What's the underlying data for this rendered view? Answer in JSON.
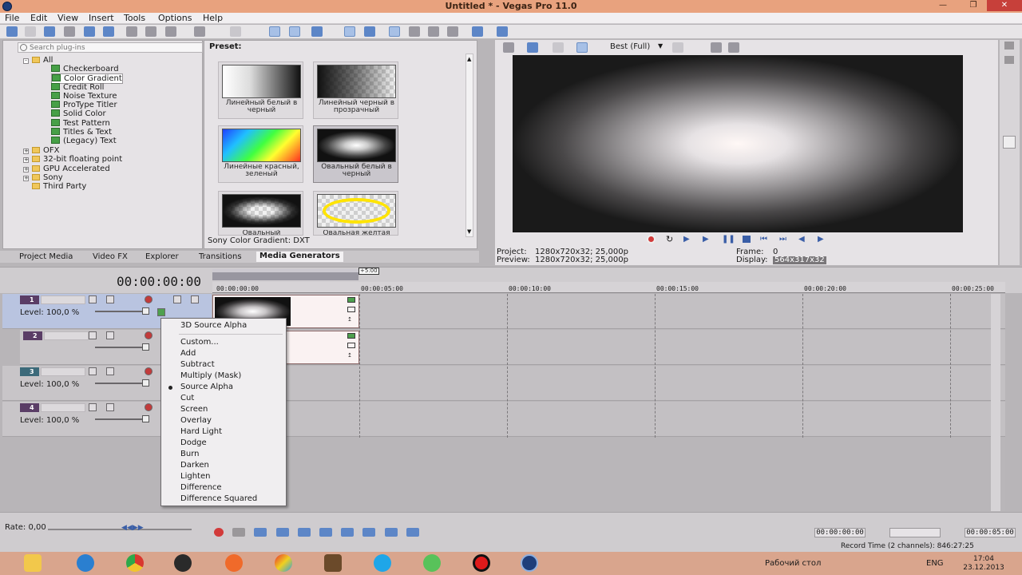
{
  "window": {
    "title": "Untitled * - Vegas Pro 11.0"
  },
  "menu": [
    "File",
    "Edit",
    "View",
    "Insert",
    "Tools",
    "Options",
    "Help"
  ],
  "explorer": {
    "search_placeholder": "Search plug-ins",
    "tree": {
      "root": "All",
      "children": [
        "Checkerboard",
        "Color Gradient",
        "Credit Roll",
        "Noise Texture",
        "ProType Titler",
        "Solid Color",
        "Test Pattern",
        "Titles & Text",
        "(Legacy) Text"
      ],
      "selected_child": "Color Gradient",
      "groups": [
        "OFX",
        "32-bit floating point",
        "GPU Accelerated",
        "Sony",
        "Third Party"
      ]
    }
  },
  "presets": {
    "label": "Preset:",
    "items": [
      {
        "caption": "Линейный белый в черный"
      },
      {
        "caption": "Линейный черный в прозрачный"
      },
      {
        "caption": "Линейные красный, зеленый"
      },
      {
        "caption": "Овальный белый в черный"
      },
      {
        "caption": "Овальный"
      },
      {
        "caption": "Овальная желтая"
      }
    ],
    "footer": "Sony Color Gradient: DXT"
  },
  "tabs": [
    "Project Media",
    "Video FX",
    "Explorer",
    "Transitions",
    "Media Generators"
  ],
  "active_tab": "Media Generators",
  "preview": {
    "quality": "Best (Full)",
    "project_label": "Project:",
    "project_value": "1280x720x32; 25,000p",
    "preview_label": "Preview:",
    "preview_value": "1280x720x32; 25,000p",
    "frame_label": "Frame:",
    "frame_value": "0",
    "display_label": "Display:",
    "display_value": "564x317x32"
  },
  "timeline": {
    "timecode": "00:00:00:00",
    "loop_flag": "+5:00",
    "ticks": [
      "00:00:00:00",
      "00:00:05:00",
      "00:00:10:00",
      "00:00:15:00",
      "00:00:20:00",
      "00:00:25:00"
    ],
    "tracks": [
      {
        "number": "1",
        "level": "Level: 100,0 %"
      },
      {
        "number": "2",
        "level": ""
      },
      {
        "number": "3",
        "level": "Level: 100,0 %"
      },
      {
        "number": "4",
        "level": "Level: 100,0 %"
      }
    ]
  },
  "context_menu": {
    "items": [
      {
        "label": "3D Source Alpha",
        "hotkey": "3"
      },
      {
        "label": "Custom...",
        "hotkey": "C"
      },
      {
        "label": "Add",
        "hotkey": "A"
      },
      {
        "label": "Subtract",
        "hotkey": "S"
      },
      {
        "label": "Multiply (Mask)",
        "hotkey": "M"
      },
      {
        "label": "Source Alpha",
        "hotkey": ""
      },
      {
        "label": "Cut",
        "hotkey": ""
      },
      {
        "label": "Screen",
        "hotkey": ""
      },
      {
        "label": "Overlay",
        "hotkey": ""
      },
      {
        "label": "Hard Light",
        "hotkey": ""
      },
      {
        "label": "Dodge",
        "hotkey": ""
      },
      {
        "label": "Burn",
        "hotkey": ""
      },
      {
        "label": "Darken",
        "hotkey": ""
      },
      {
        "label": "Lighten",
        "hotkey": ""
      },
      {
        "label": "Difference",
        "hotkey": ""
      },
      {
        "label": "Difference Squared",
        "hotkey": ""
      }
    ],
    "checked": "Source Alpha"
  },
  "transport": {
    "rate": "Rate: 0,00",
    "cursor_time": "00:00:00:00",
    "length_time": "00:00:05:00",
    "record_time": "Record Time (2 channels): 846:27:25"
  },
  "taskbar": {
    "desktop": "Рабочий стол",
    "lang": "ENG",
    "time": "17:04",
    "date": "23.12.2013"
  },
  "colors": {
    "accent": "#5d86c7",
    "titlebar": "#e8a27e",
    "taskbar": "#d9a58d",
    "close": "#c7403a",
    "track_header": "#5a3d66"
  }
}
